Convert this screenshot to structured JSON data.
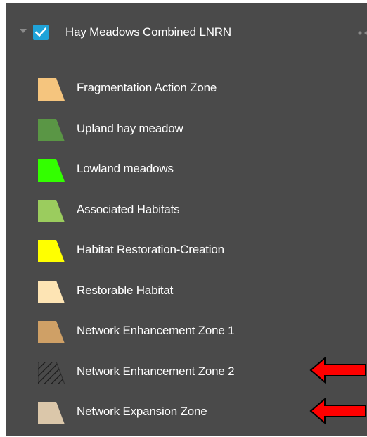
{
  "layer": {
    "title": "Hay Meadows Combined LNRN",
    "checked": true,
    "checkbox_color": "#1fa3d9"
  },
  "legend": [
    {
      "label": "Fragmentation Action Zone",
      "color": "#f5c57e",
      "pattern": "solid"
    },
    {
      "label": "Upland hay meadow",
      "color": "#5a9645",
      "pattern": "solid"
    },
    {
      "label": "Lowland meadows",
      "color": "#33ff00",
      "pattern": "solid"
    },
    {
      "label": "Associated Habitats",
      "color": "#9bcc5e",
      "pattern": "solid"
    },
    {
      "label": "Habitat Restoration-Creation",
      "color": "#ffff00",
      "pattern": "solid"
    },
    {
      "label": "Restorable Habitat",
      "color": "#fde4b4",
      "pattern": "solid"
    },
    {
      "label": "Network Enhancement Zone 1",
      "color": "#cfa066",
      "pattern": "solid"
    },
    {
      "label": "Network Enhancement Zone 2",
      "color": "#2e2e2e",
      "pattern": "hatch"
    },
    {
      "label": "Network Expansion Zone",
      "color": "#dbc7aa",
      "pattern": "solid"
    }
  ],
  "annotations": {
    "arrow_color": "#ff0000",
    "arrow_targets": [
      "Network Enhancement Zone 2",
      "Network Expansion Zone"
    ]
  },
  "icons": {
    "expander": "triangle-down-icon",
    "checkbox": "checkmark-icon",
    "more": "more-options-icon"
  }
}
